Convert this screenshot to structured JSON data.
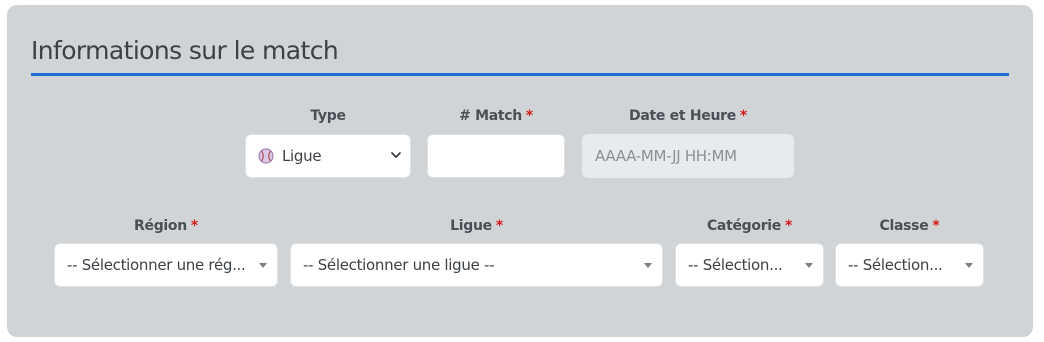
{
  "section": {
    "title": "Informations sur le match"
  },
  "colors": {
    "accent": "#1a6fd0",
    "required": "#d11a1a",
    "card_bg": "#d1d4d6"
  },
  "fields": {
    "type": {
      "label": "Type",
      "value": "Ligue",
      "icon": "baseball-icon"
    },
    "match_number": {
      "label": "# Match",
      "required_mark": "*",
      "value": ""
    },
    "date_time": {
      "label": "Date et Heure",
      "required_mark": "*",
      "placeholder": "AAAA-MM-JJ HH:MM"
    },
    "region": {
      "label": "Région",
      "required_mark": "*",
      "value": "-- Sélectionner une rég..."
    },
    "league": {
      "label": "Ligue",
      "required_mark": "*",
      "value": "-- Sélectionner une ligue --"
    },
    "category": {
      "label": "Catégorie",
      "required_mark": "*",
      "value": "-- Sélection..."
    },
    "class": {
      "label": "Classe",
      "required_mark": "*",
      "value": "-- Sélection..."
    }
  }
}
